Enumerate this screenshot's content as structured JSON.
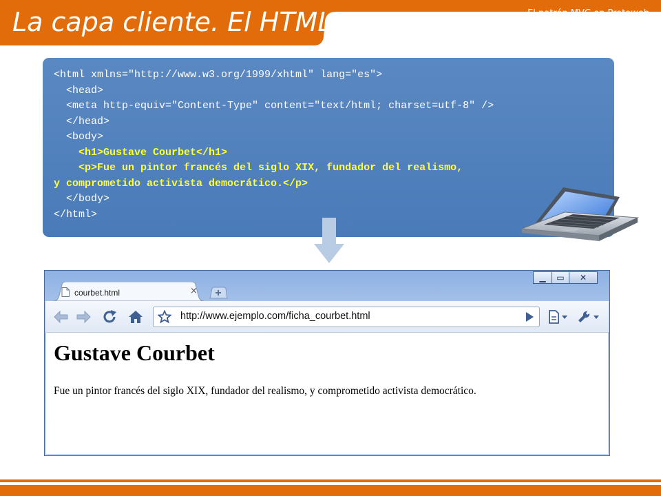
{
  "slide": {
    "title": "La capa cliente. El HTML",
    "corner_caption": "El patrón MVC en Protoweb"
  },
  "code": {
    "lines": [
      {
        "text": "<html xmlns=\"http://www.w3.org/1999/xhtml\" lang=\"es\">",
        "indent": "",
        "highlight": false
      },
      {
        "text": "<head>",
        "indent": "  ",
        "highlight": false
      },
      {
        "text": "<meta http-equiv=\"Content-Type\" content=\"text/html; charset=utf-8\" />",
        "indent": "  ",
        "highlight": false
      },
      {
        "text": "</head>",
        "indent": "  ",
        "highlight": false
      },
      {
        "text": "<body>",
        "indent": "  ",
        "highlight": false
      },
      {
        "text": "<h1>Gustave Courbet</h1>",
        "indent": "    ",
        "highlight": true
      },
      {
        "text": "<p>Fue un pintor francés del siglo XIX, fundador del realismo,",
        "indent": "    ",
        "highlight": true
      },
      {
        "text": "y comprometido activista democrático.</p>",
        "indent": "",
        "highlight": true
      },
      {
        "text": "</body>",
        "indent": "  ",
        "highlight": false
      },
      {
        "text": "</html>",
        "indent": "",
        "highlight": false
      }
    ]
  },
  "browser": {
    "tab_title": "courbet.html",
    "tab_close": "×",
    "url": "http://www.ejemplo.com/ficha_courbet.html",
    "window_controls": [
      "▁",
      "▭",
      "✕"
    ],
    "toolbar_icons": [
      "back-icon",
      "forward-icon",
      "reload-icon",
      "home-icon",
      "star-icon",
      "go-icon",
      "page-menu-icon",
      "wrench-menu-icon"
    ],
    "page": {
      "heading": "Gustave Courbet",
      "paragraph": "Fue un pintor francés del siglo XIX, fundador del realismo, y comprometido activista democrático."
    }
  },
  "colors": {
    "accent_orange": "#e36c0a",
    "code_panel_blue": "#4f81bd",
    "highlight_yellow": "#ffff33",
    "browser_frame_blue": "#7ea4da",
    "arrow_blue": "#b8cce4"
  }
}
